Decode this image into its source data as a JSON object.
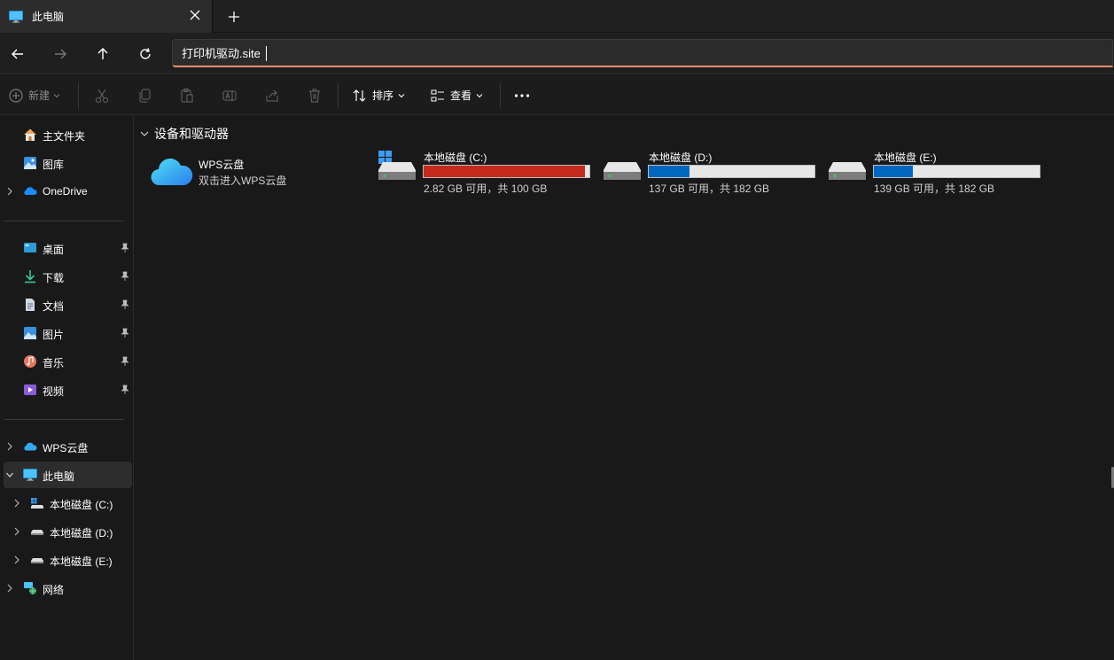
{
  "tab": {
    "title": "此电脑"
  },
  "address": {
    "value": "打印机驱动.site"
  },
  "command": {
    "new_label": "新建",
    "sort_label": "排序",
    "view_label": "查看"
  },
  "sidebar": {
    "quick": [
      {
        "label": "主文件夹",
        "icon": "home-icon"
      },
      {
        "label": "图库",
        "icon": "gallery-icon"
      },
      {
        "label": "OneDrive",
        "icon": "onedrive-icon"
      }
    ],
    "pinned": [
      {
        "label": "桌面",
        "icon": "desktop-icon"
      },
      {
        "label": "下载",
        "icon": "download-icon"
      },
      {
        "label": "文档",
        "icon": "document-icon"
      },
      {
        "label": "图片",
        "icon": "picture-icon"
      },
      {
        "label": "音乐",
        "icon": "music-icon"
      },
      {
        "label": "视频",
        "icon": "video-icon"
      }
    ],
    "tree": [
      {
        "label": "WPS云盘",
        "icon": "wps-cloud-icon"
      },
      {
        "label": "此电脑",
        "icon": "this-pc-icon"
      },
      {
        "label": "本地磁盘 (C:)",
        "icon": "drive-c-icon"
      },
      {
        "label": "本地磁盘 (D:)",
        "icon": "drive-icon"
      },
      {
        "label": "本地磁盘 (E:)",
        "icon": "drive-icon"
      },
      {
        "label": "网络",
        "icon": "network-icon"
      }
    ]
  },
  "content": {
    "group_title": "设备和驱动器",
    "wps": {
      "name": "WPS云盘",
      "sub": "双击进入WPS云盘"
    },
    "drives": [
      {
        "name": "本地磁盘 (C:)",
        "info": "2.82 GB 可用，共 100 GB",
        "used_fraction": 0.972,
        "color": "#c42b1c"
      },
      {
        "name": "本地磁盘 (D:)",
        "info": "137 GB 可用，共 182 GB",
        "used_fraction": 0.247,
        "color": "#0067c0"
      },
      {
        "name": "本地磁盘 (E:)",
        "info": "139 GB 可用，共 182 GB",
        "used_fraction": 0.236,
        "color": "#0067c0"
      }
    ]
  },
  "colors": {
    "accent": "#ee8b6e",
    "warn": "#c42b1c",
    "normal": "#0067c0"
  }
}
